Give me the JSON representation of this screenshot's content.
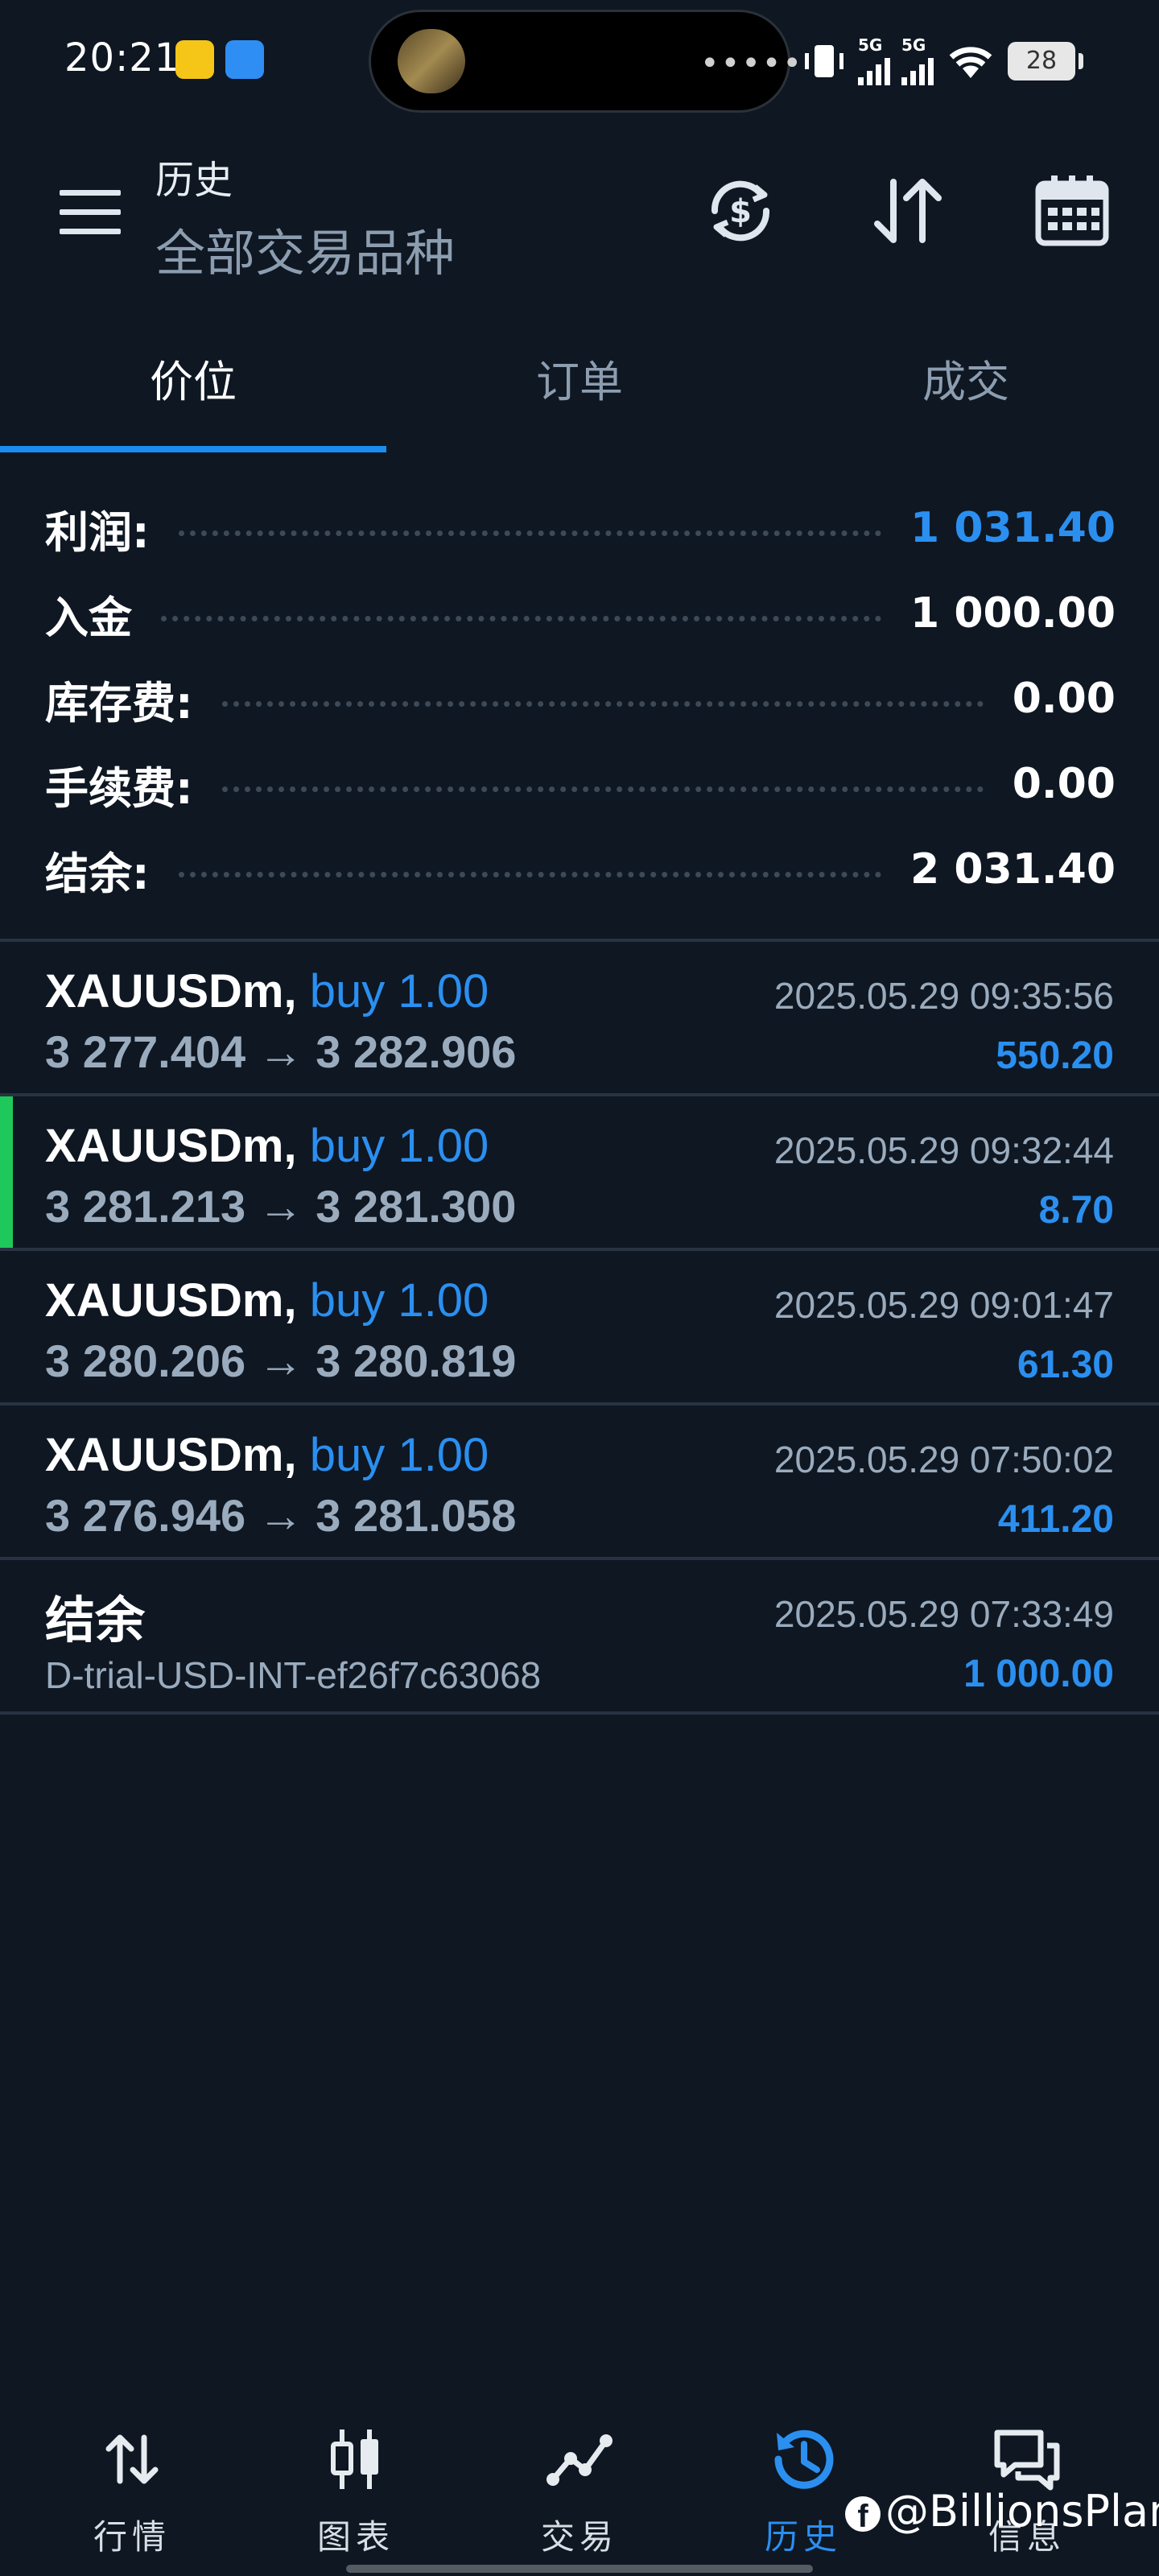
{
  "status_bar": {
    "time": "20:21",
    "signal_1": "5G",
    "signal_2": "5G",
    "battery": "28",
    "pill_dots": "•••••"
  },
  "header": {
    "title": "历史",
    "subtitle": "全部交易品种",
    "icons": [
      "menu-icon",
      "currency-refresh-icon",
      "sort-icon",
      "calendar-icon"
    ]
  },
  "tabs": [
    {
      "label": "价位",
      "active": true
    },
    {
      "label": "订单",
      "active": false
    },
    {
      "label": "成交",
      "active": false
    }
  ],
  "summary": [
    {
      "label": "利润:",
      "value": "1 031.40",
      "highlight": true
    },
    {
      "label": "入金",
      "value": "1 000.00",
      "highlight": false
    },
    {
      "label": "库存费:",
      "value": "0.00",
      "highlight": false
    },
    {
      "label": "手续费:",
      "value": "0.00",
      "highlight": false
    },
    {
      "label": "结余:",
      "value": "2 031.40",
      "highlight": false
    }
  ],
  "deals": [
    {
      "symbol": "XAUUSDm,",
      "direction": "buy 1.00",
      "prices": "3 277.404 → 3 282.906",
      "time": "2025.05.29 09:35:56",
      "profit": "550.20",
      "selected": false
    },
    {
      "symbol": "XAUUSDm,",
      "direction": "buy 1.00",
      "prices": "3 281.213 → 3 281.300",
      "time": "2025.05.29 09:32:44",
      "profit": "8.70",
      "selected": true
    },
    {
      "symbol": "XAUUSDm,",
      "direction": "buy 1.00",
      "prices": "3 280.206 → 3 280.819",
      "time": "2025.05.29 09:01:47",
      "profit": "61.30",
      "selected": false
    },
    {
      "symbol": "XAUUSDm,",
      "direction": "buy 1.00",
      "prices": "3 276.946 → 3 281.058",
      "time": "2025.05.29 07:50:02",
      "profit": "411.20",
      "selected": false
    }
  ],
  "balance_entry": {
    "title": "结余",
    "comment": "D-trial-USD-INT-ef26f7c63068",
    "time": "2025.05.29 07:33:49",
    "amount": "1 000.00"
  },
  "bottom_nav": [
    {
      "label": "行情",
      "icon": "quotes-icon",
      "active": false
    },
    {
      "label": "图表",
      "icon": "chart-icon",
      "active": false
    },
    {
      "label": "交易",
      "icon": "trade-icon",
      "active": false
    },
    {
      "label": "历史",
      "icon": "history-icon",
      "active": true
    },
    {
      "label": "信息",
      "icon": "messages-icon",
      "active": false
    }
  ],
  "watermark": "@BillionsPlan",
  "colors": {
    "background": "#0e1722",
    "accent": "#2b8ff0",
    "selected_marker": "#1ec85a",
    "muted_text": "#9aabbd"
  }
}
